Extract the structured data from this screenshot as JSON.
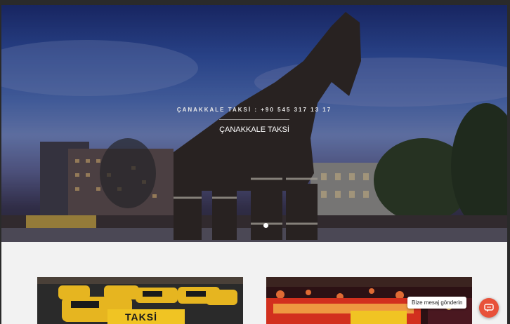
{
  "hero": {
    "subtitle": "ÇANAKKALE TAKSİ : +90 545 317 13 17",
    "title": "ÇANAKKALE TAKSİ",
    "slider_active_index": 1,
    "slider_count": 1
  },
  "cards": [
    {
      "image": "taxi-fleet-photo",
      "sign_text": "TAKSİ"
    },
    {
      "image": "night-street-photo"
    }
  ],
  "chat": {
    "label": "Bize mesaj gönderin",
    "icon": "chat-icon",
    "accent": "#e8513a"
  }
}
